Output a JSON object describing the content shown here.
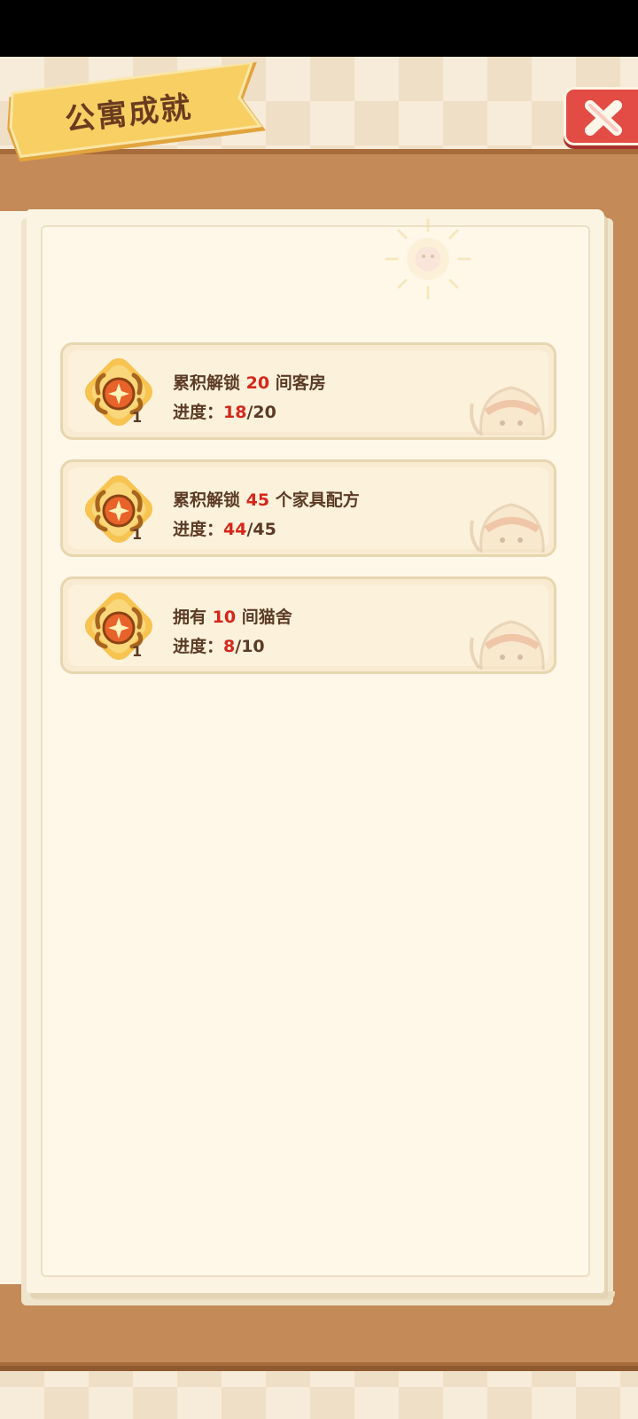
{
  "header": {
    "title": "公寓成就"
  },
  "colors": {
    "accent_red": "#d5261b",
    "text_brown": "#5b3b26",
    "ribbon_yellow": "#f6c85a",
    "close_red": "#e34b45",
    "board_brown": "#c48a57"
  },
  "icons": {
    "close": "close-x-icon",
    "badge": "laurel-medal-icon",
    "watermark": "cat-icon"
  },
  "achievements": [
    {
      "badge_count": "1",
      "title_prefix": "累积解锁 ",
      "title_number": "20",
      "title_suffix": " 间客房",
      "progress_label": "进度：",
      "progress_current": "18",
      "progress_total": "/20"
    },
    {
      "badge_count": "1",
      "title_prefix": "累积解锁 ",
      "title_number": "45",
      "title_suffix": " 个家具配方",
      "progress_label": "进度：",
      "progress_current": "44",
      "progress_total": "/45"
    },
    {
      "badge_count": "1",
      "title_prefix": "拥有 ",
      "title_number": "10",
      "title_suffix": " 间猫舍",
      "progress_label": "进度：",
      "progress_current": "8",
      "progress_total": "/10"
    }
  ]
}
